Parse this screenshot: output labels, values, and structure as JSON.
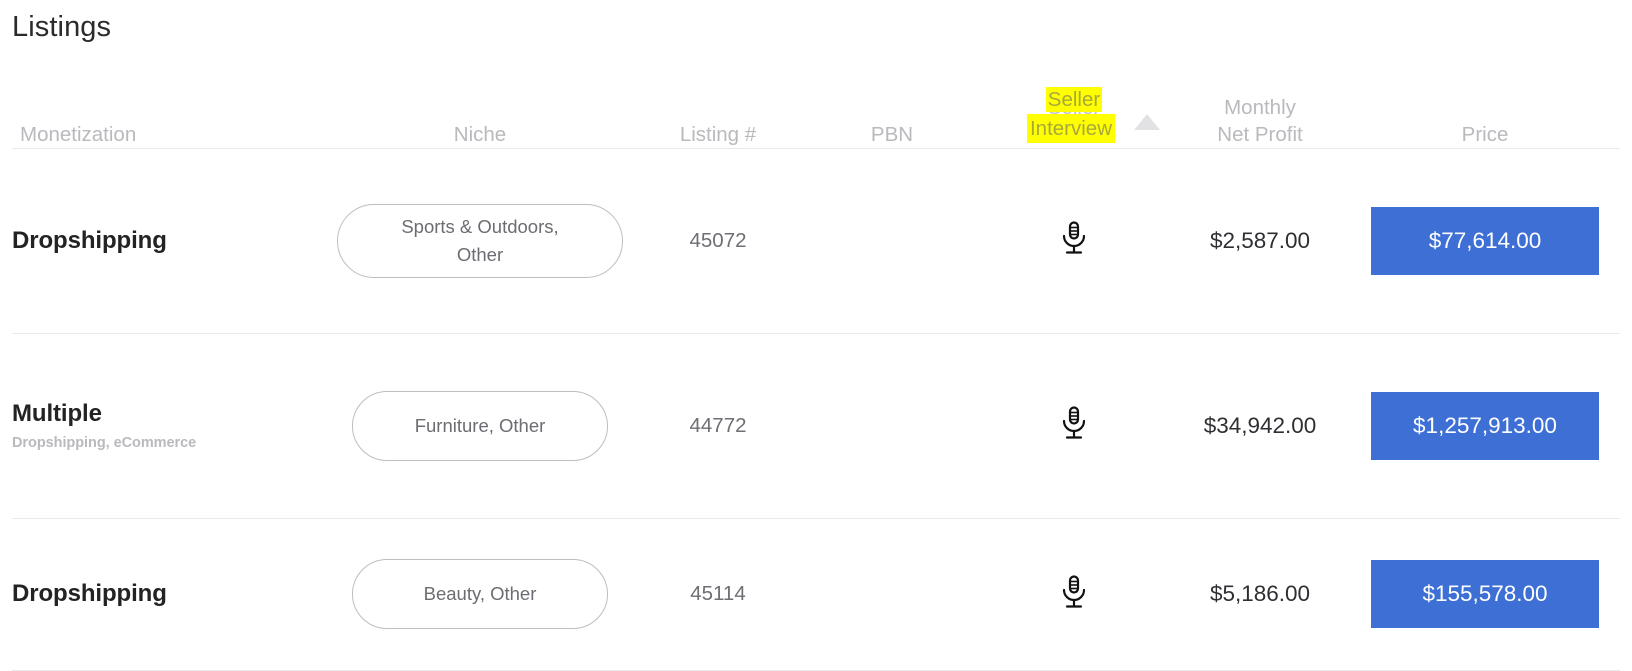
{
  "page": {
    "title": "Listings"
  },
  "table": {
    "columns": [
      {
        "key": "monetization",
        "label": "Monetization",
        "align": "left"
      },
      {
        "key": "niche",
        "label": "Niche",
        "align": "center"
      },
      {
        "key": "listing_number",
        "label": "Listing #",
        "align": "center"
      },
      {
        "key": "pbn",
        "label": "PBN",
        "align": "center"
      },
      {
        "key": "seller_interview",
        "label": "Seller Interview",
        "align": "center"
      },
      {
        "key": "monthly_net_profit",
        "label": "Monthly Net Profit",
        "align": "center"
      },
      {
        "key": "price",
        "label": "Price",
        "align": "center"
      }
    ],
    "header": {
      "monetization": "Monetization",
      "niche": "Niche",
      "listing_number": "Listing #",
      "pbn": "PBN",
      "seller_interview_line1": "Seller",
      "seller_interview_line2": "Interview",
      "seller_interview_full": "Seller Interview",
      "monthly_net_profit_line1": "Monthly",
      "monthly_net_profit_line2": "Net Profit",
      "price": "Price"
    },
    "sort": {
      "column": "Seller Interview",
      "direction": "ascending",
      "indicator": "triangle-up-icon"
    },
    "highlight": {
      "target": "Seller Interview",
      "color": "#ffff00",
      "text_line1": "Seller",
      "text_line2": "Interview"
    },
    "rows": [
      {
        "monetization": "Dropshipping",
        "monetization_sub": "",
        "niche": "Sports & Outdoors, Other",
        "niche_line1": "Sports & Outdoors,",
        "niche_line2": "Other",
        "listing_number": "45072",
        "pbn": "",
        "seller_interview": "microphone-icon",
        "monthly_net_profit": "$2,587.00",
        "price": "$77,614.00"
      },
      {
        "monetization": "Multiple",
        "monetization_sub": "Dropshipping, eCommerce",
        "niche": "Furniture, Other",
        "niche_line1": "Furniture, Other",
        "niche_line2": "",
        "listing_number": "44772",
        "pbn": "",
        "seller_interview": "microphone-icon",
        "monthly_net_profit": "$34,942.00",
        "price": "$1,257,913.00"
      },
      {
        "monetization": "Dropshipping",
        "monetization_sub": "",
        "niche": "Beauty, Other",
        "niche_line1": "Beauty, Other",
        "niche_line2": "",
        "listing_number": "45114",
        "pbn": "",
        "seller_interview": "microphone-icon",
        "monthly_net_profit": "$5,186.00",
        "price": "$155,578.00"
      }
    ]
  },
  "colors": {
    "price_background": "#3d6fd4",
    "price_text": "#ffffff",
    "highlight_yellow": "#ffff00",
    "header_text": "#b9b9be",
    "row_divider": "#e9e9ec",
    "sort_arrow": "#e2e2e5"
  }
}
